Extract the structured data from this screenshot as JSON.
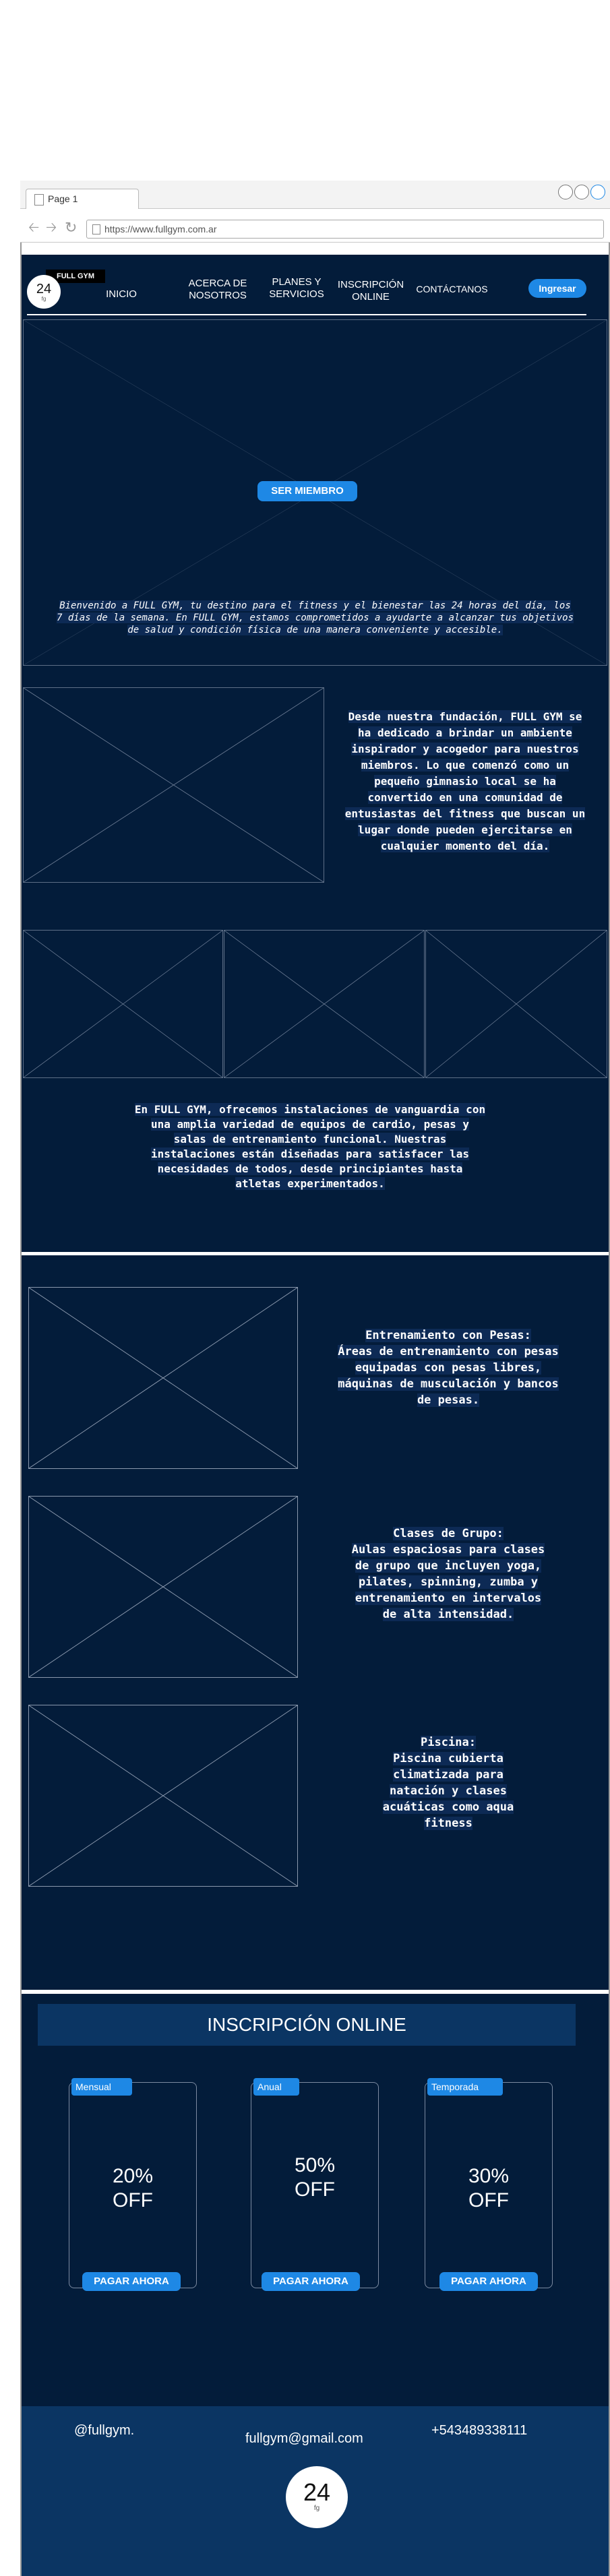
{
  "browser": {
    "tab_title": "Page 1",
    "url": "https://www.fullgym.com.ar"
  },
  "header": {
    "logo_badge": "FULL GYM",
    "logo_number": "24",
    "logo_sub": "fg",
    "nav": {
      "inicio": "INICIO",
      "acerca_1": "ACERCA DE",
      "acerca_2": "NOSOTROS",
      "planes_1": "PLANES Y",
      "planes_2": "SERVICIOS",
      "inscripcion_1": "INSCRIPCIÓN",
      "inscripcion_2": "ONLINE",
      "contacto": "CONTÁCTANOS"
    },
    "login_button": "Ingresar"
  },
  "hero": {
    "cta_button": "SER MIEMBRO",
    "intro_line1": "Bienvenido a FULL GYM, tu destino para el fitness y el bienestar las 24 horas del día, los",
    "intro_line2": "7 días de la semana. En FULL GYM, estamos comprometidos a ayudarte a alcanzar tus objetivos",
    "intro_line3": "de salud y condición física de una manera conveniente y accesible."
  },
  "about": {
    "lines": [
      "Desde nuestra fundación, FULL GYM se",
      "ha dedicado a brindar un ambiente",
      "inspirador y acogedor para nuestros",
      "miembros. Lo que comenzó como un",
      "pequeño gimnasio local se ha",
      "convertido en una comunidad de",
      "entusiastas del fitness que buscan un",
      "lugar donde pueden ejercitarse en",
      "cualquier momento del día."
    ]
  },
  "facilities": {
    "lines": [
      "En FULL GYM, ofrecemos instalaciones de vanguardia con",
      "una amplia variedad de equipos de cardio, pesas y",
      "salas de entrenamiento funcional. Nuestras",
      "instalaciones están diseñadas para satisfacer las",
      "necesidades de todos, desde principiantes hasta",
      "atletas experimentados."
    ]
  },
  "services": [
    {
      "lines": [
        "Entrenamiento con Pesas:",
        "Áreas de entrenamiento con pesas",
        "equipadas con pesas libres,",
        "máquinas de musculación y bancos",
        "de pesas."
      ]
    },
    {
      "lines": [
        "Clases de Grupo:",
        "Aulas espaciosas para clases",
        "de grupo que incluyen yoga,",
        "pilates, spinning, zumba y",
        "entrenamiento en intervalos",
        "de alta intensidad."
      ]
    },
    {
      "lines": [
        "Piscina:",
        "Piscina cubierta",
        "climatizada para",
        "natación y clases",
        "acuáticas como aqua",
        "fitness"
      ]
    }
  ],
  "signup": {
    "title": "INSCRIPCIÓN ONLINE",
    "plans": [
      {
        "tag": "Mensual",
        "discount": "20%",
        "off": "OFF",
        "button": "PAGAR AHORA"
      },
      {
        "tag": "Anual",
        "discount": "50%",
        "off": "OFF",
        "button": "PAGAR AHORA"
      },
      {
        "tag": "Temporada",
        "discount": "30%",
        "off": "OFF",
        "button": "PAGAR AHORA"
      }
    ]
  },
  "footer": {
    "social": "@fullgym.",
    "email": "fullgym@gmail.com",
    "phone": "+543489338111",
    "logo_number": "24",
    "logo_sub": "fg"
  },
  "colors": {
    "navy": "#031c3a",
    "footer_navy": "#0b3563",
    "accent": "#1e88e5"
  }
}
